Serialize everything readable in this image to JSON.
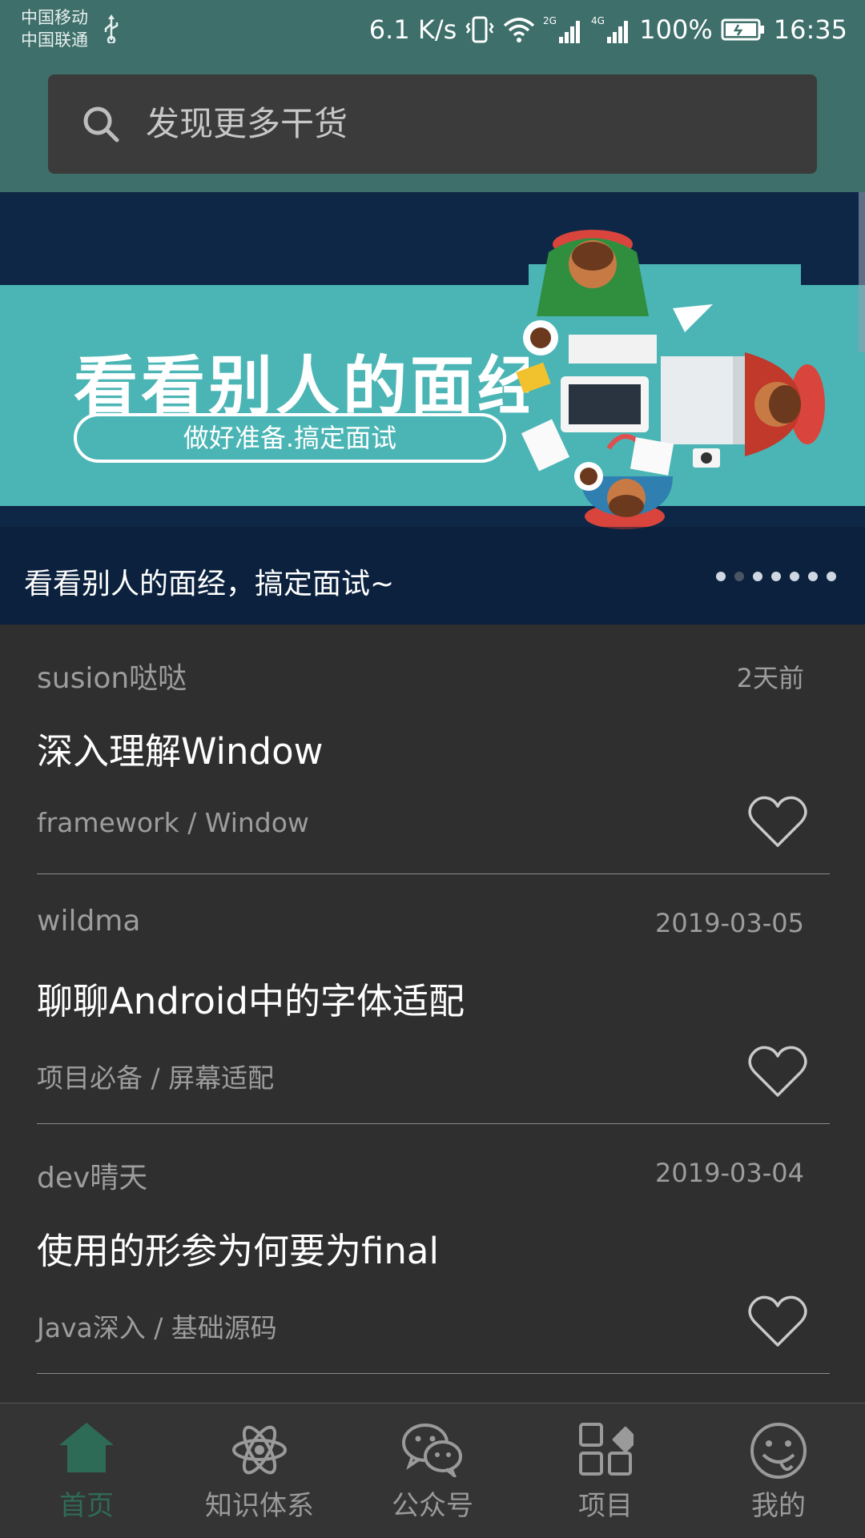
{
  "status_bar": {
    "carrier_1": "中国移动",
    "carrier_2": "中国联通",
    "net_speed": "6.1 K/s",
    "net_2g": "2G",
    "net_4g": "4G",
    "battery": "100%",
    "time": "16:35"
  },
  "search": {
    "placeholder": "发现更多干货"
  },
  "banner": {
    "headline": "看看别人的面经",
    "pill_text": "做好准备.搞定面试",
    "caption": "看看别人的面经，搞定面试~",
    "dot_count": 7,
    "active_dot": 1
  },
  "articles": [
    {
      "author": "susion哒哒",
      "date": "2天前",
      "title": "深入理解Window",
      "category": "framework / Window"
    },
    {
      "author": "wildma",
      "date": "2019-03-05",
      "title": "聊聊Android中的字体适配",
      "category": "项目必备 / 屏幕适配"
    },
    {
      "author": "dev晴天",
      "date": "2019-03-04",
      "title": "使用的形参为何要为final",
      "category": "Java深入 / 基础源码"
    }
  ],
  "bottom_nav": {
    "items": [
      {
        "label": "首页",
        "icon": "home-icon"
      },
      {
        "label": "知识体系",
        "icon": "atom-icon"
      },
      {
        "label": "公众号",
        "icon": "wechat-icon"
      },
      {
        "label": "项目",
        "icon": "grid-icon"
      },
      {
        "label": "我的",
        "icon": "smiley-icon"
      }
    ],
    "active_index": 0
  },
  "colors": {
    "primary": "#3e6f6b",
    "background": "#2f2f2f",
    "active_nav": "#2e6b57",
    "banner_teal": "#4bb5b5",
    "banner_navy": "#0f2746"
  }
}
